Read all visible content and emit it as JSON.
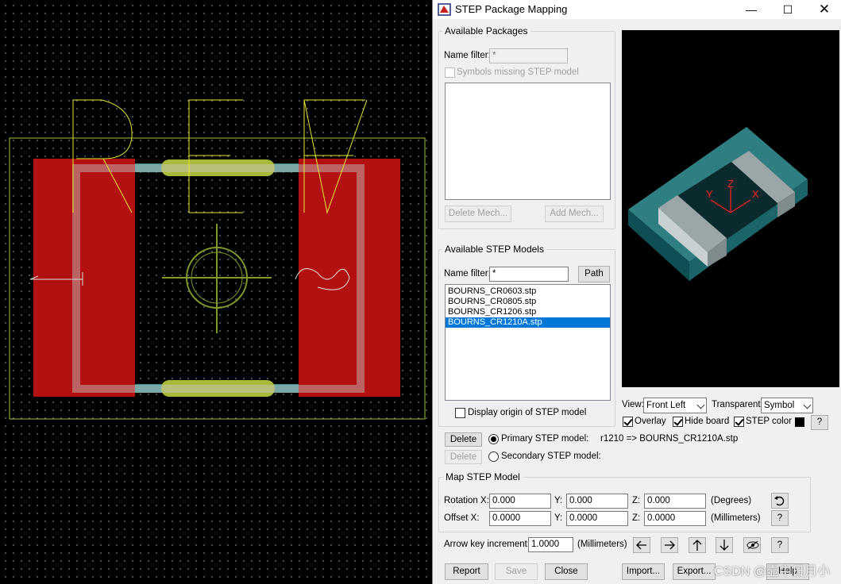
{
  "canvas": {
    "ref_text": "REF",
    "colors": {
      "pad": "#b31111",
      "silk": "#ffff33",
      "outline": "#9ec43a"
    }
  },
  "dialog": {
    "title": "STEP Package Mapping",
    "window_buttons": {
      "minimize": "—",
      "maximize": "☐",
      "close": "✕"
    },
    "available_packages": {
      "label": "Available Packages",
      "name_filter_label": "Name filter:",
      "name_filter_value": "*",
      "missing_label": "Symbols missing STEP model",
      "delete_mech": "Delete Mech...",
      "add_mech": "Add Mech..."
    },
    "available_step": {
      "label": "Available STEP Models",
      "name_filter_label": "Name filter:",
      "name_filter_value": "*",
      "path_button": "Path",
      "items": [
        "BOURNS_CR0603.stp",
        "BOURNS_CR0805.stp",
        "BOURNS_CR1206.stp",
        "BOURNS_CR1210A.stp"
      ],
      "selected_index": 3,
      "display_origin": "Display origin of STEP model"
    },
    "view": {
      "view_label": "View:",
      "view_value": "Front Left",
      "transparent_label": "Transparent:",
      "transparent_value": "Symbol",
      "overlay": "Overlay",
      "hide_board": "Hide board",
      "step_color": "STEP color",
      "help": "?"
    },
    "preview": {
      "axis_x": "X",
      "axis_y": "Y",
      "axis_z": "Z"
    },
    "primary": {
      "delete": "Delete",
      "label": "Primary STEP model:",
      "mapping": "r1210 => BOURNS_CR1210A.stp"
    },
    "secondary": {
      "delete": "Delete",
      "label": "Secondary STEP model:"
    },
    "map": {
      "label": "Map STEP Model",
      "rotation_label": "Rotation X:",
      "offset_label": "Offset X:",
      "y_label": "Y:",
      "z_label": "Z:",
      "rotation": {
        "x": "0.000",
        "y": "0.000",
        "z": "0.000"
      },
      "offset": {
        "x": "0.0000",
        "y": "0.0000",
        "z": "0.0000"
      },
      "degrees": "(Degrees)",
      "millimeters": "(Millimeters)",
      "help": "?"
    },
    "arrow": {
      "label": "Arrow key increment:",
      "value": "1.0000",
      "unit": "(Millimeters)",
      "help": "?"
    },
    "footer": {
      "report": "Report",
      "save": "Save",
      "close": "Close",
      "import": "Import...",
      "export": "Export...",
      "help": "Help"
    },
    "watermark": "CSDN @壶中日月小"
  }
}
